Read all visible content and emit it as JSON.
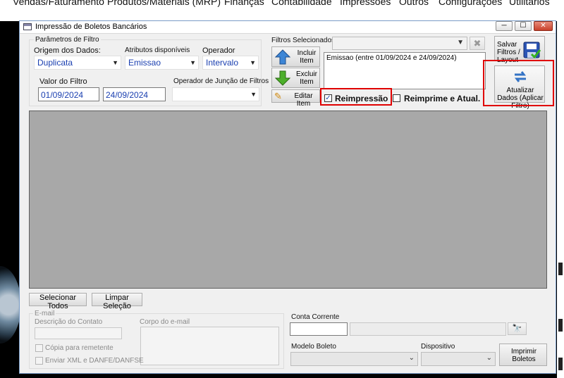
{
  "menubar": {
    "items": [
      "Vendas/Faturamento",
      "Produtos/Materiais (MRP)",
      "Finanças",
      "Contabilidade",
      "Impressões",
      "Outros",
      "Configurações",
      "Utilitários"
    ]
  },
  "window": {
    "title": "Impressão de Boletos Bancários",
    "minimize": "─",
    "maximize": "☐",
    "close": "✕"
  },
  "filter": {
    "group_label": "Parâmetros de Filtro",
    "origem_label": "Origem dos Dados:",
    "origem_value": "Duplicata",
    "atributos_label": "Atributos disponíveis",
    "atributos_value": "Emissao",
    "operador_label": "Operador",
    "operador_value": "Intervalo",
    "valor_label": "Valor do Filtro",
    "valor_from": "01/09/2024",
    "valor_to": "24/09/2024",
    "juncao_label": "Operador de Junção de Filtros",
    "juncao_value": ""
  },
  "selected_filters": {
    "label": "Filtros Selecionados",
    "items": [
      "Emissao (entre 01/09/2024 e 24/09/2024)"
    ],
    "incluir_label": "Incluir Item",
    "excluir_label": "Excluir Item",
    "editar_label": "Editar Item",
    "reimpressao_label": "Reimpressão",
    "reimpressao_checked": "✓",
    "reimprime_label": "Reimprime e Atual.",
    "salvar_label": "Salvar Filtros / Layout",
    "atualizar_label": "Atualizar Dados (Aplicar Filtro)"
  },
  "actions": {
    "selecionar_todos": "Selecionar Todos",
    "limpar_selecao": "Limpar Seleção"
  },
  "email": {
    "group_label": "E-mail",
    "descricao_label": "Descrição do Contato",
    "corpo_label": "Corpo do e-mail",
    "copia_label": "Cópia para remetente",
    "enviar_xml_label": "Enviar XML e DANFE/DANFSE"
  },
  "boleto": {
    "conta_label": "Conta Corrente",
    "modelo_label": "Modelo Boleto",
    "dispositivo_label": "Dispositivo",
    "imprimir_label": "Imprimir Boletos"
  },
  "colors": {
    "accent_blue": "#1a3fb0",
    "highlight_red": "#e00000",
    "grid_gray": "#a8a8a8"
  }
}
